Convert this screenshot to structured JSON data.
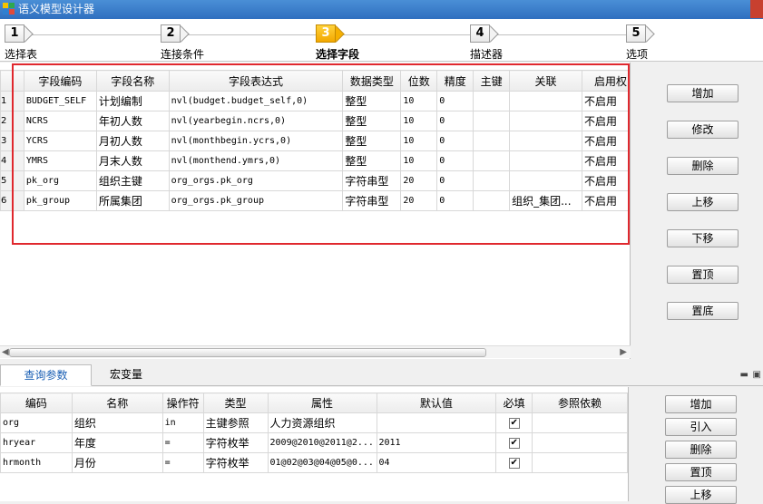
{
  "window": {
    "title": "语义模型设计器"
  },
  "steps": [
    {
      "num": "1",
      "label": "选择表"
    },
    {
      "num": "2",
      "label": "连接条件"
    },
    {
      "num": "3",
      "label": "选择字段"
    },
    {
      "num": "4",
      "label": "描述器"
    },
    {
      "num": "5",
      "label": "选项"
    }
  ],
  "fields_table": {
    "columns": [
      "字段编码",
      "字段名称",
      "字段表达式",
      "数据类型",
      "位数",
      "精度",
      "主键",
      "关联",
      "启用权"
    ],
    "rows": [
      {
        "n": "1",
        "code": "BUDGET_SELF",
        "name": "计划编制",
        "expr": "nvl(budget.budget_self,0)",
        "type": "整型",
        "digits": "10",
        "precision": "0",
        "pk": "",
        "rel": "",
        "enable": "不启用"
      },
      {
        "n": "2",
        "code": "NCRS",
        "name": "年初人数",
        "expr": "nvl(yearbegin.ncrs,0)",
        "type": "整型",
        "digits": "10",
        "precision": "0",
        "pk": "",
        "rel": "",
        "enable": "不启用"
      },
      {
        "n": "3",
        "code": "YCRS",
        "name": "月初人数",
        "expr": "nvl(monthbegin.ycrs,0)",
        "type": "整型",
        "digits": "10",
        "precision": "0",
        "pk": "",
        "rel": "",
        "enable": "不启用"
      },
      {
        "n": "4",
        "code": "YMRS",
        "name": "月末人数",
        "expr": "nvl(monthend.ymrs,0)",
        "type": "整型",
        "digits": "10",
        "precision": "0",
        "pk": "",
        "rel": "",
        "enable": "不启用"
      },
      {
        "n": "5",
        "code": "pk_org",
        "name": "组织主键",
        "expr": "org_orgs.pk_org",
        "type": "字符串型",
        "digits": "20",
        "precision": "0",
        "pk": "",
        "rel": "",
        "enable": "不启用"
      },
      {
        "n": "6",
        "code": "pk_group",
        "name": "所属集团",
        "expr": "org_orgs.pk_group",
        "type": "字符串型",
        "digits": "20",
        "precision": "0",
        "pk": "",
        "rel": "组织_集团...",
        "enable": "不启用"
      }
    ]
  },
  "side_buttons": [
    "增加",
    "修改",
    "删除",
    "上移",
    "下移",
    "置顶",
    "置底"
  ],
  "bottom_tabs": [
    "查询参数",
    "宏变量"
  ],
  "params_table": {
    "columns": [
      "编码",
      "名称",
      "操作符",
      "类型",
      "属性",
      "默认值",
      "必填",
      "参照依赖"
    ],
    "rows": [
      {
        "code": "org",
        "name": "组织",
        "op": "in",
        "type": "主键参照",
        "attr": "人力资源组织",
        "default": "",
        "required": "✔",
        "dep": ""
      },
      {
        "code": "hryear",
        "name": "年度",
        "op": "=",
        "type": "字符枚举",
        "attr": "2009@2010@2011@2...",
        "default": "2011",
        "required": "✔",
        "dep": ""
      },
      {
        "code": "hrmonth",
        "name": "月份",
        "op": "=",
        "type": "字符枚举",
        "attr": "01@02@03@04@05@0...",
        "default": "04",
        "required": "✔",
        "dep": ""
      }
    ]
  },
  "param_buttons": [
    "增加",
    "引入",
    "删除",
    "置顶",
    "上移"
  ]
}
